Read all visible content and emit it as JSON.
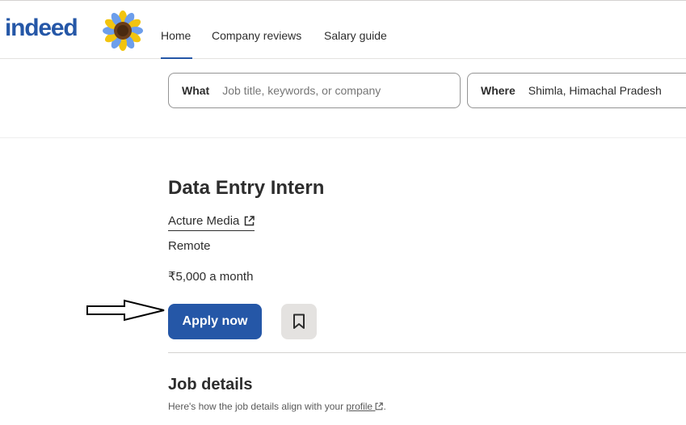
{
  "header": {
    "logo_text": "indeed",
    "nav": [
      {
        "label": "Home",
        "active": true
      },
      {
        "label": "Company reviews"
      },
      {
        "label": "Salary guide"
      }
    ]
  },
  "search": {
    "what_label": "What",
    "what_placeholder": "Job title, keywords, or company",
    "where_label": "Where",
    "where_value": "Shimla, Himachal Pradesh"
  },
  "job": {
    "title": "Data Entry Intern",
    "company": "Acture Media",
    "location": "Remote",
    "salary": "₹5,000 a month",
    "apply_label": "Apply now"
  },
  "details": {
    "heading": "Job details",
    "subtext_prefix": "Here's how the job details align with your",
    "profile_link": "profile",
    "subtext_suffix": "."
  },
  "colors": {
    "brand_blue": "#2557a7",
    "text": "#2d2d2d",
    "save_bg": "#e4e2e0"
  },
  "icons": {
    "logo": "sunflower-icon",
    "external": "external-link-icon",
    "save": "bookmark-icon",
    "pointer": "arrow-right-icon"
  }
}
